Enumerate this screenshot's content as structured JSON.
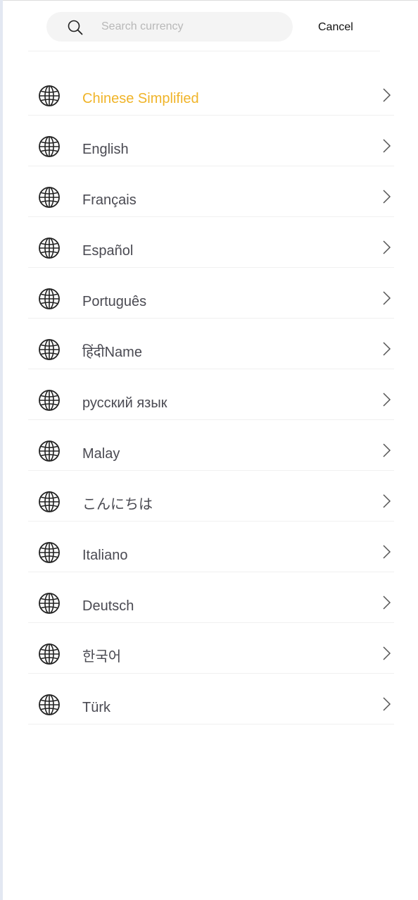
{
  "search": {
    "placeholder": "Search currency",
    "value": ""
  },
  "header": {
    "cancel_label": "Cancel"
  },
  "colors": {
    "accent": "#f0b429",
    "text": "#4a4a52"
  },
  "languages": [
    {
      "label": "Chinese Simplified",
      "active": true
    },
    {
      "label": "English",
      "active": false
    },
    {
      "label": "Français",
      "active": false
    },
    {
      "label": "Español",
      "active": false
    },
    {
      "label": "Português",
      "active": false
    },
    {
      "label": "हिंदीName",
      "active": false
    },
    {
      "label": "русский язык",
      "active": false
    },
    {
      "label": "Malay",
      "active": false
    },
    {
      "label": "こんにちは",
      "active": false
    },
    {
      "label": "Italiano",
      "active": false
    },
    {
      "label": "Deutsch",
      "active": false
    },
    {
      "label": "한국어",
      "active": false
    },
    {
      "label": "Türk",
      "active": false
    }
  ]
}
